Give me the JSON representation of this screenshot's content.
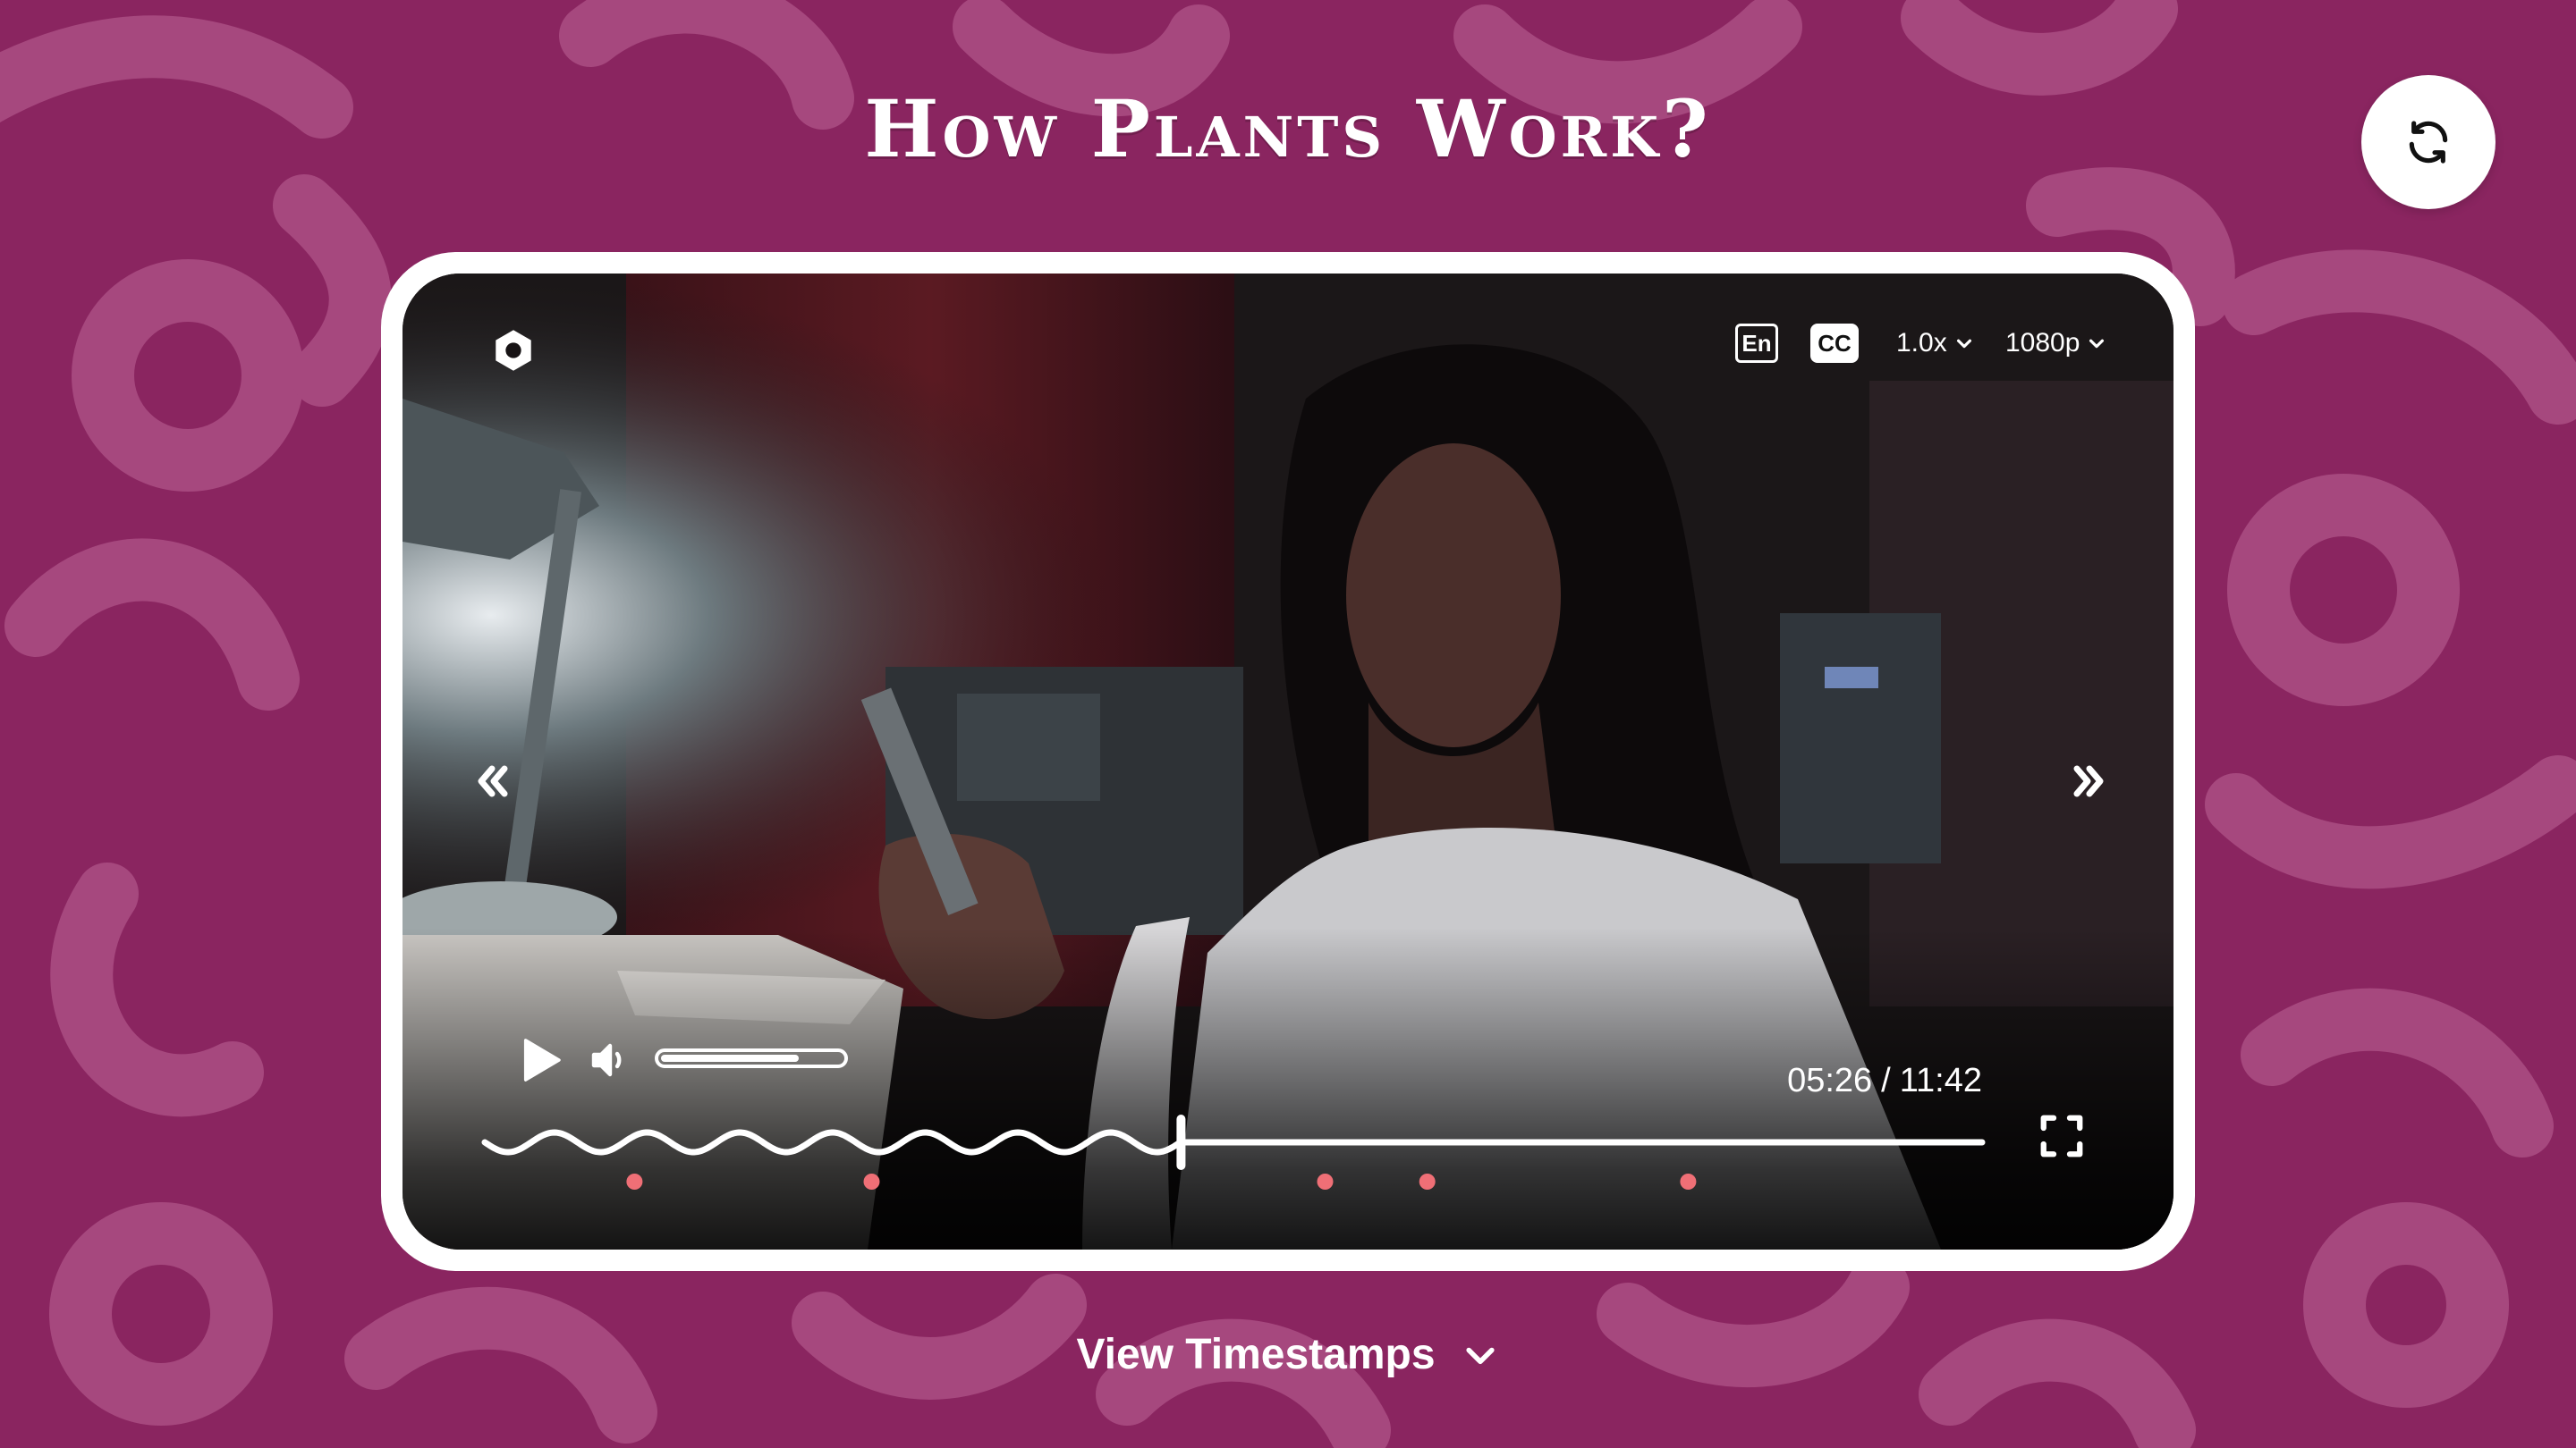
{
  "page": {
    "title": "How Plants Work?",
    "background_color": "#8a2560",
    "pattern_color": "#a84a80",
    "accent_marker_color": "#ef6f76"
  },
  "toolbar": {
    "refresh_icon": "refresh-icon"
  },
  "player": {
    "settings_icon": "gear-icon",
    "language": "En",
    "captions": "CC",
    "speed": "1.0x",
    "quality": "1080p",
    "current_time": "05:26",
    "time_separator": "/",
    "duration": "11:42",
    "progress_fraction": 0.465,
    "volume_fraction": 0.76,
    "chapter_marker_count": 5
  },
  "footer": {
    "timestamps_label": "View Timestamps"
  }
}
